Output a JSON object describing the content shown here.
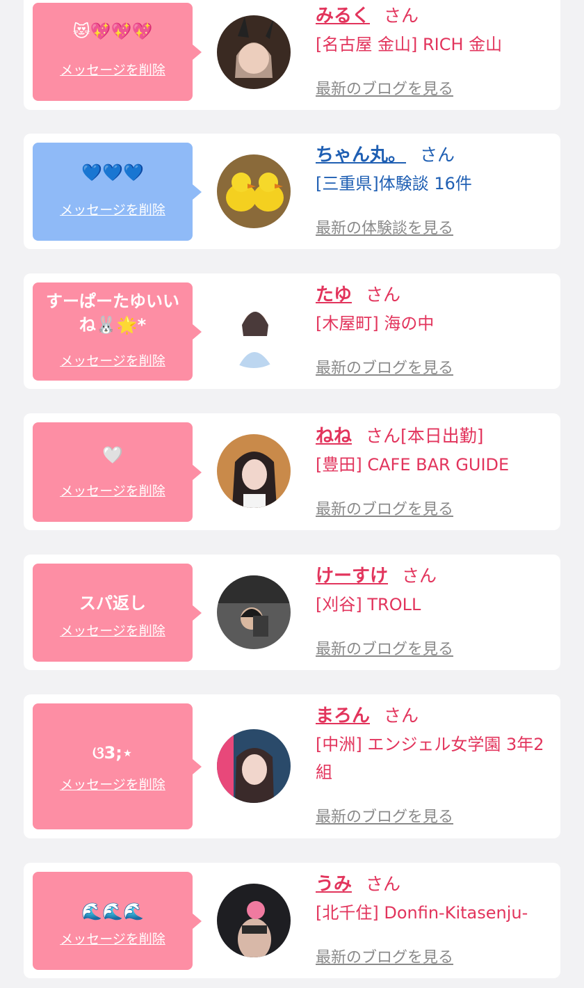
{
  "delete_label": "メッセージを削除",
  "colors": {
    "pink": "#fd8ea4",
    "blue": "#8fbaf7",
    "name_pink": "#e2345c",
    "name_blue": "#1f5fb3",
    "link_gray": "#8a8a8a"
  },
  "favorites": [
    {
      "message": "😻💖💖💖",
      "name": "みるく",
      "honorific": "さん",
      "status": "",
      "shop": "[名古屋 金山] RICH 金山",
      "link": "最新のブログを見る",
      "avatar_icon": "photo-avatar-icon"
    },
    {
      "message": "💙💙💙",
      "name": "ちゃん丸。",
      "honorific": "さん",
      "status": "",
      "shop": "[三重県]体験談 16件",
      "link": "最新の体験談を見る",
      "avatar_icon": "rubber-ducks-avatar-icon"
    },
    {
      "message": "すーぱーたゆいいね🐰🌟*",
      "name": "たゆ",
      "honorific": "さん",
      "status": "",
      "shop": "[木屋町] 海の中",
      "link": "最新のブログを見る",
      "avatar_icon": "photo-avatar-icon"
    },
    {
      "message": "🤍",
      "name": "ねね",
      "honorific": "さん",
      "status": "[本日出勤]",
      "shop": "[豊田] CAFE BAR GUIDE",
      "link": "最新のブログを見る",
      "avatar_icon": "photo-avatar-icon"
    },
    {
      "message": "スパ返し",
      "name": "けーすけ",
      "honorific": "さん",
      "status": "",
      "shop": "[刈谷] TROLL",
      "link": "最新のブログを見る",
      "avatar_icon": "photo-avatar-icon"
    },
    {
      "message": "ଓ3;⋆",
      "name": "まろん",
      "honorific": "さん",
      "status": "",
      "shop": "[中洲] エンジェル女学園 3年2組",
      "link": "最新のブログを見る",
      "avatar_icon": "photo-avatar-icon"
    },
    {
      "message": "🌊🌊🌊",
      "name": "うみ",
      "honorific": "さん",
      "status": "",
      "shop": "[北千住] Donfin-Kitasenju-",
      "link": "最新のブログを見る",
      "avatar_icon": "photo-avatar-icon"
    }
  ]
}
